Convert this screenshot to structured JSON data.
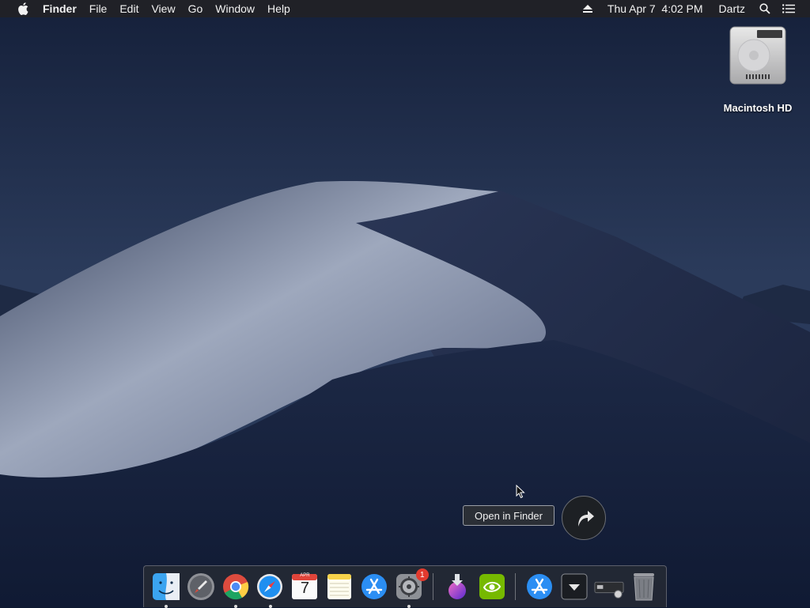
{
  "menubar": {
    "apple_icon": "apple-icon",
    "app_name": "Finder",
    "menus": [
      "File",
      "Edit",
      "View",
      "Go",
      "Window",
      "Help"
    ],
    "clock": "Thu Apr 7  4:02 PM",
    "user": "Dartz",
    "icons": [
      "eject-icon",
      "spotlight-search-icon",
      "notification-center-icon"
    ]
  },
  "desktop": {
    "drive_label": "Macintosh HD",
    "tooltip": "Open in Finder"
  },
  "dock": {
    "apps": [
      {
        "name": "finder",
        "running": true
      },
      {
        "name": "launchpad",
        "running": false
      },
      {
        "name": "google-chrome",
        "running": true
      },
      {
        "name": "safari",
        "running": true
      },
      {
        "name": "calendar",
        "running": false
      },
      {
        "name": "notes",
        "running": false
      },
      {
        "name": "app-store",
        "running": false
      },
      {
        "name": "system-preferences",
        "running": true,
        "badge": "1"
      },
      {
        "name": "installer-download",
        "running": false
      },
      {
        "name": "nvidia",
        "running": false
      }
    ],
    "calendar_month": "APR",
    "calendar_day": "7",
    "stack_items": [
      "app-store-downloads",
      "downloads-stack",
      "drive-stack",
      "trash"
    ]
  },
  "colors": {
    "sky_top": "#16203a",
    "sky_mid": "#2c3d5e",
    "dune_light": "#a8b2c8",
    "dune_dark": "#1a2440",
    "badge": "#e23a2e"
  }
}
